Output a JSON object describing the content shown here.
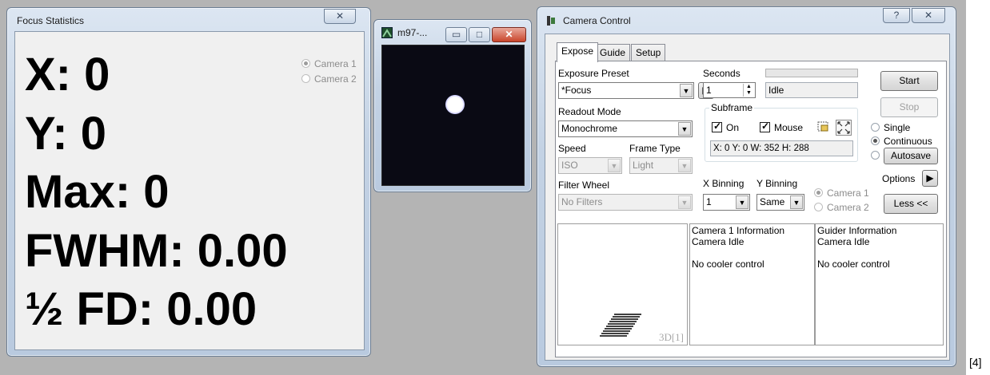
{
  "footnote": "[4]",
  "focus_window": {
    "title": "Focus Statistics",
    "close": "✕",
    "stats": {
      "x": "X: 0",
      "y": "Y: 0",
      "max": "Max: 0",
      "fwhm": "FWHM: 0.00",
      "half_fd": "½ FD: 0.00"
    },
    "cameras": [
      "Camera 1",
      "Camera 2"
    ],
    "selected_camera": "Camera 1"
  },
  "image_window": {
    "title": "m97-...",
    "buttons": {
      "minimize": "▭",
      "maximize": "□",
      "close": "✕"
    }
  },
  "camera_window": {
    "title": "Camera Control",
    "help": "?",
    "close": "✕",
    "tabs": [
      "Expose",
      "Guide",
      "Setup"
    ],
    "active_tab": "Expose",
    "exposure_preset": {
      "label": "Exposure Preset",
      "value": "*Focus"
    },
    "seconds": {
      "label": "Seconds",
      "value": "1"
    },
    "status": "Idle",
    "progress": 0,
    "readout_mode": {
      "label": "Readout Mode",
      "value": "Monochrome"
    },
    "speed": {
      "label": "Speed",
      "value": "ISO"
    },
    "frame_type": {
      "label": "Frame Type",
      "value": "Light"
    },
    "filter_wheel": {
      "label": "Filter Wheel",
      "value": "No Filters"
    },
    "subframe": {
      "label": "Subframe",
      "on_label": "On",
      "mouse_label": "Mouse",
      "readout": "X:  0 Y:  0 W: 352 H: 288"
    },
    "x_binning": {
      "label": "X Binning",
      "value": "1"
    },
    "y_binning": {
      "label": "Y Binning",
      "value": "Same"
    },
    "binning_cameras": [
      "Camera 1",
      "Camera 2"
    ],
    "buttons": {
      "start": "Start",
      "stop": "Stop",
      "autosave": "Autosave",
      "options": "Options",
      "less": "Less <<"
    },
    "modes": [
      "Single",
      "Continuous"
    ],
    "selected_mode": "Continuous",
    "preview_label": "3D[1]",
    "camera1_info": "Camera 1 Information\nCamera Idle\n\nNo cooler control",
    "guider_info": "Guider Information\nCamera Idle\n\nNo cooler control"
  }
}
